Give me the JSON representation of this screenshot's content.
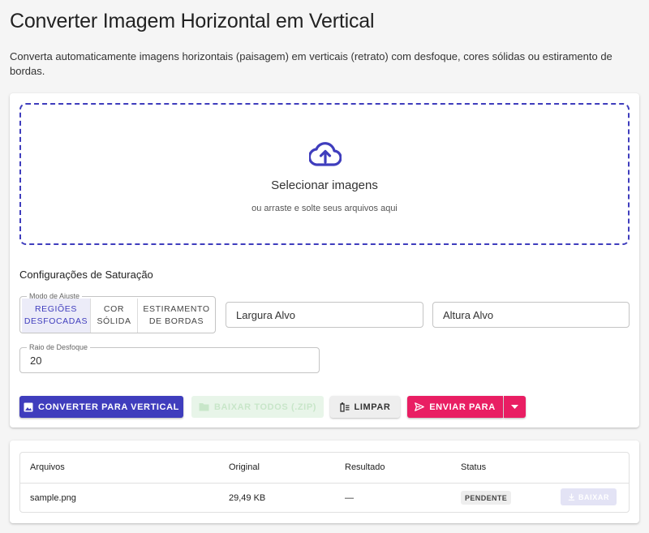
{
  "header": {
    "title": "Converter Imagem Horizontal em Vertical",
    "description": "Converta automaticamente imagens horizontais (paisagem) em verticais (retrato) com desfoque, cores sólidas ou estiramento de bordas."
  },
  "dropzone": {
    "icon": "cloud-upload-icon",
    "title": "Selecionar imagens",
    "subtitle": "ou arraste e solte seus arquivos aqui"
  },
  "settings": {
    "title": "Configurações de Saturação",
    "mode": {
      "legend": "Modo de Ajuste",
      "options": [
        {
          "line1": "Regiões",
          "line2": "Desfocadas",
          "selected": true
        },
        {
          "line1": "Cor",
          "line2": "Sólida",
          "selected": false
        },
        {
          "line1": "Estiramento",
          "line2": "de Bordas",
          "selected": false
        }
      ]
    },
    "width_placeholder": "Largura Alvo",
    "height_placeholder": "Altura Alvo",
    "blur": {
      "label": "Raio de Desfoque",
      "value": "20"
    }
  },
  "actions": {
    "convert": "Converter para Vertical",
    "download_zip": "Baixar Todos (.ZIP)",
    "clear": "Limpar",
    "send_to": "Enviar para"
  },
  "table": {
    "headers": [
      "Arquivos",
      "Original",
      "Resultado",
      "Status"
    ],
    "rows": [
      {
        "file": "sample.png",
        "original": "29,49 KB",
        "result": "—",
        "status": "Pendente",
        "download": "Baixar"
      }
    ]
  },
  "colors": {
    "primary": "#3f3dbd",
    "accent": "#e91e63",
    "success_disabled": "#e8f5e9"
  }
}
